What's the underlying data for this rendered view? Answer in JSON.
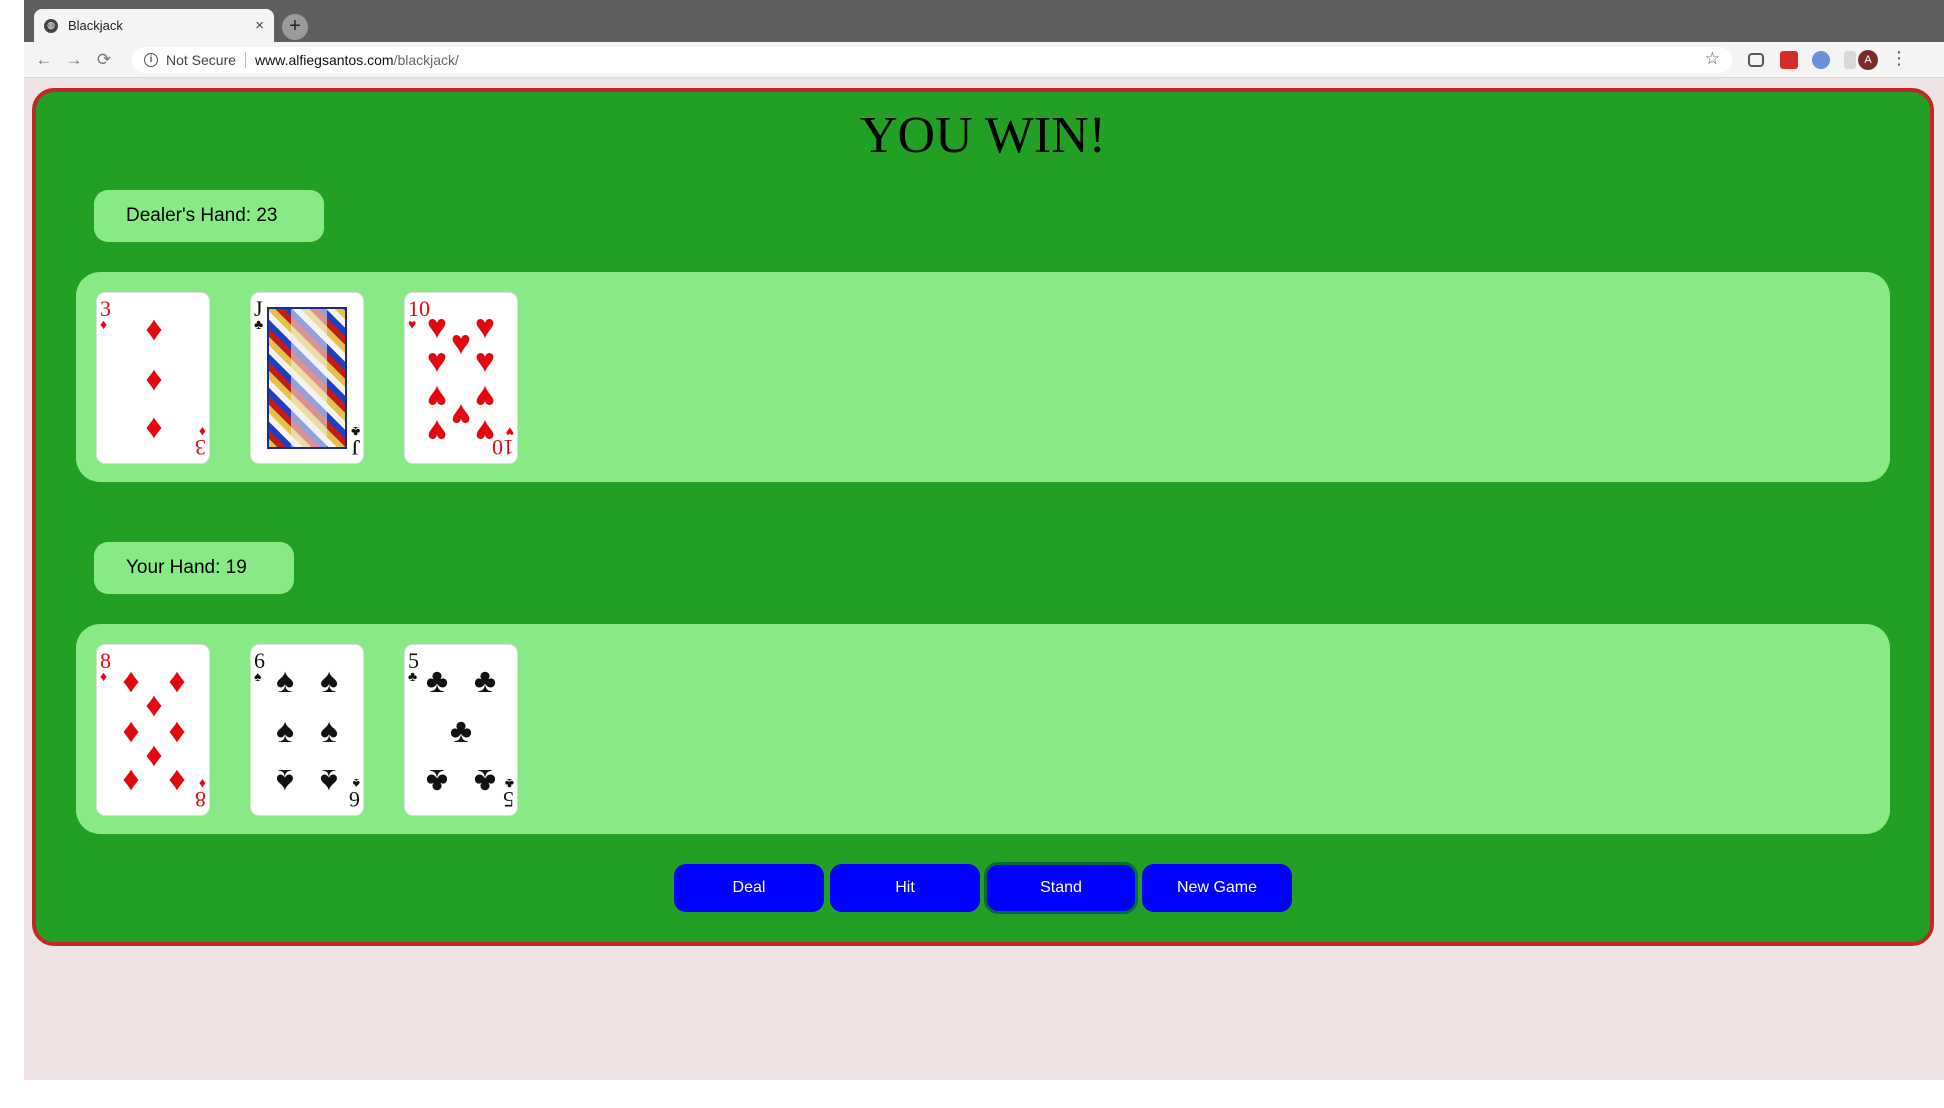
{
  "browser": {
    "tab_title": "Blackjack",
    "close_glyph": "×",
    "new_tab_glyph": "+",
    "security": "Not Secure",
    "url_domain": "www.alfiegsantos.com",
    "url_path": "/blackjack/",
    "profile_initial": "A"
  },
  "game": {
    "result": "YOU WIN!",
    "dealer": {
      "label": "Dealer's Hand: 23",
      "cards": [
        {
          "rank": "3",
          "suit": "diamonds",
          "suit_glyph": "♦"
        },
        {
          "rank": "J",
          "suit": "clubs",
          "suit_glyph": "♣"
        },
        {
          "rank": "10",
          "suit": "hearts",
          "suit_glyph": "♥"
        }
      ]
    },
    "player": {
      "label": "Your Hand: 19",
      "cards": [
        {
          "rank": "8",
          "suit": "diamonds",
          "suit_glyph": "♦"
        },
        {
          "rank": "6",
          "suit": "spades",
          "suit_glyph": "♠"
        },
        {
          "rank": "5",
          "suit": "clubs",
          "suit_glyph": "♣"
        }
      ]
    },
    "buttons": {
      "deal": "Deal",
      "hit": "Hit",
      "stand": "Stand",
      "new_game": "New Game"
    }
  },
  "colors": {
    "table_green": "#22a024",
    "panel_green": "#87ea85",
    "border_red": "#c12929",
    "button_blue": "#0000ff",
    "card_red": "#e3070f"
  }
}
